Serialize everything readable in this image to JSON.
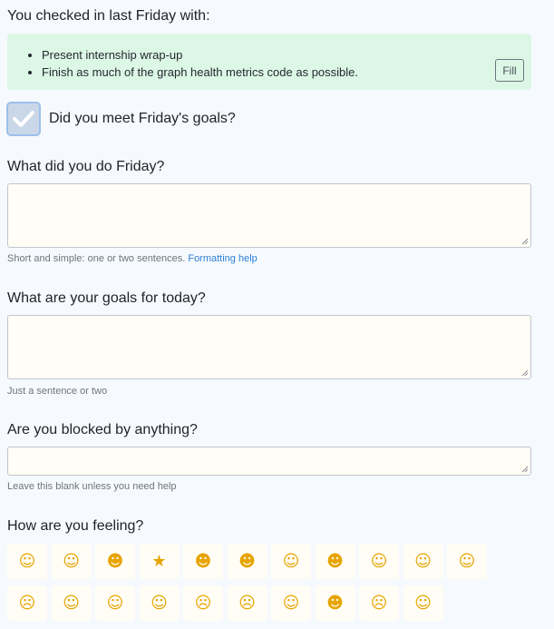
{
  "checkin": {
    "title": "You checked in last Friday with:",
    "goals": [
      "Present internship wrap-up",
      "Finish as much of the graph health metrics code as possible."
    ],
    "fill_label": "Fill"
  },
  "goals_met": {
    "label": "Did you meet Friday's goals?",
    "checked": true
  },
  "q_friday": {
    "label": "What did you do Friday?",
    "help": "Short and simple: one or two sentences.",
    "help_link": "Formatting help",
    "value": ""
  },
  "q_today": {
    "label": "What are your goals for today?",
    "help": "Just a sentence or two",
    "value": ""
  },
  "q_blocked": {
    "label": "Are you blocked by anything?",
    "help": "Leave this blank unless you need help",
    "value": ""
  },
  "feeling": {
    "label": "How are you feeling?",
    "emojis": [
      "relieved-face-icon",
      "slightly-smiling-face-icon",
      "hugging-face-icon",
      "star-struck-icon",
      "joy-face-icon",
      "sunglasses-face-icon",
      "monocle-face-icon",
      "zany-face-icon",
      "nerd-face-icon",
      "hand-over-mouth-icon",
      "neutral-face-icon",
      "confused-face-icon",
      "flushed-face-icon",
      "open-mouth-face-icon",
      "sleeping-face-icon",
      "slightly-frowning-face-icon",
      "frowning-face-icon",
      "rolling-eyes-face-icon",
      "exploding-head-icon",
      "angry-face-icon",
      "woozy-face-icon"
    ]
  }
}
